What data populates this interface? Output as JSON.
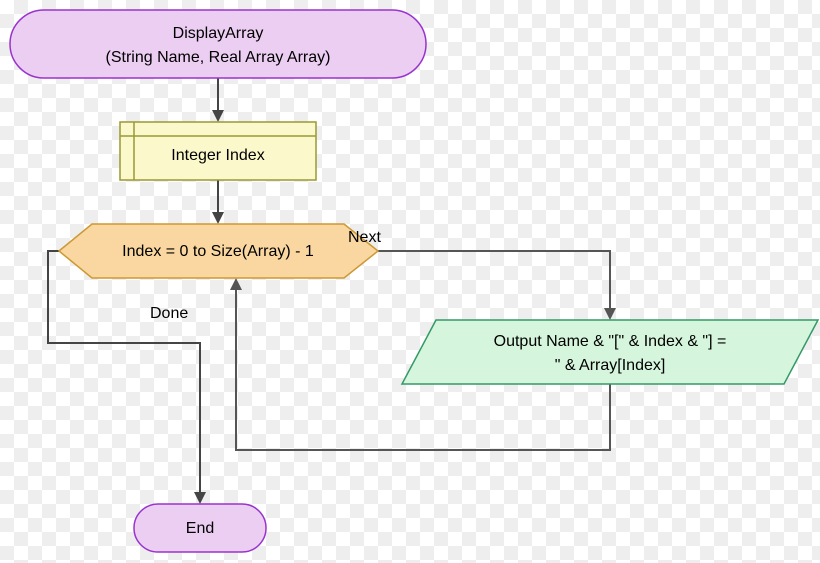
{
  "chart_data": {
    "type": "flowchart",
    "nodes": [
      {
        "id": "start",
        "kind": "terminator",
        "lines": [
          "DisplayArray",
          "(String Name, Real Array Array)"
        ]
      },
      {
        "id": "declare",
        "kind": "declaration",
        "lines": [
          "Integer Index"
        ]
      },
      {
        "id": "loop",
        "kind": "loop",
        "lines": [
          "Index = 0 to Size(Array) - 1"
        ]
      },
      {
        "id": "output",
        "kind": "output",
        "lines": [
          "Output Name & \"[\" & Index & \"] =",
          "\" & Array[Index]"
        ]
      },
      {
        "id": "end",
        "kind": "terminator",
        "lines": [
          "End"
        ]
      }
    ],
    "edges": [
      {
        "from": "start",
        "to": "declare"
      },
      {
        "from": "declare",
        "to": "loop"
      },
      {
        "from": "loop",
        "to": "output",
        "label": "Next"
      },
      {
        "from": "output",
        "to": "loop"
      },
      {
        "from": "loop",
        "to": "end",
        "label": "Done"
      }
    ]
  },
  "start_l1": "DisplayArray",
  "start_l2": "(String Name, Real Array Array)",
  "declare_l1": "Integer Index",
  "loop_l1": "Index = 0 to Size(Array) - 1",
  "output_l1": "Output Name & \"[\" & Index & \"] =",
  "output_l2": "\" & Array[Index]",
  "end_l1": "End",
  "label_next": "Next",
  "label_done": "Done"
}
